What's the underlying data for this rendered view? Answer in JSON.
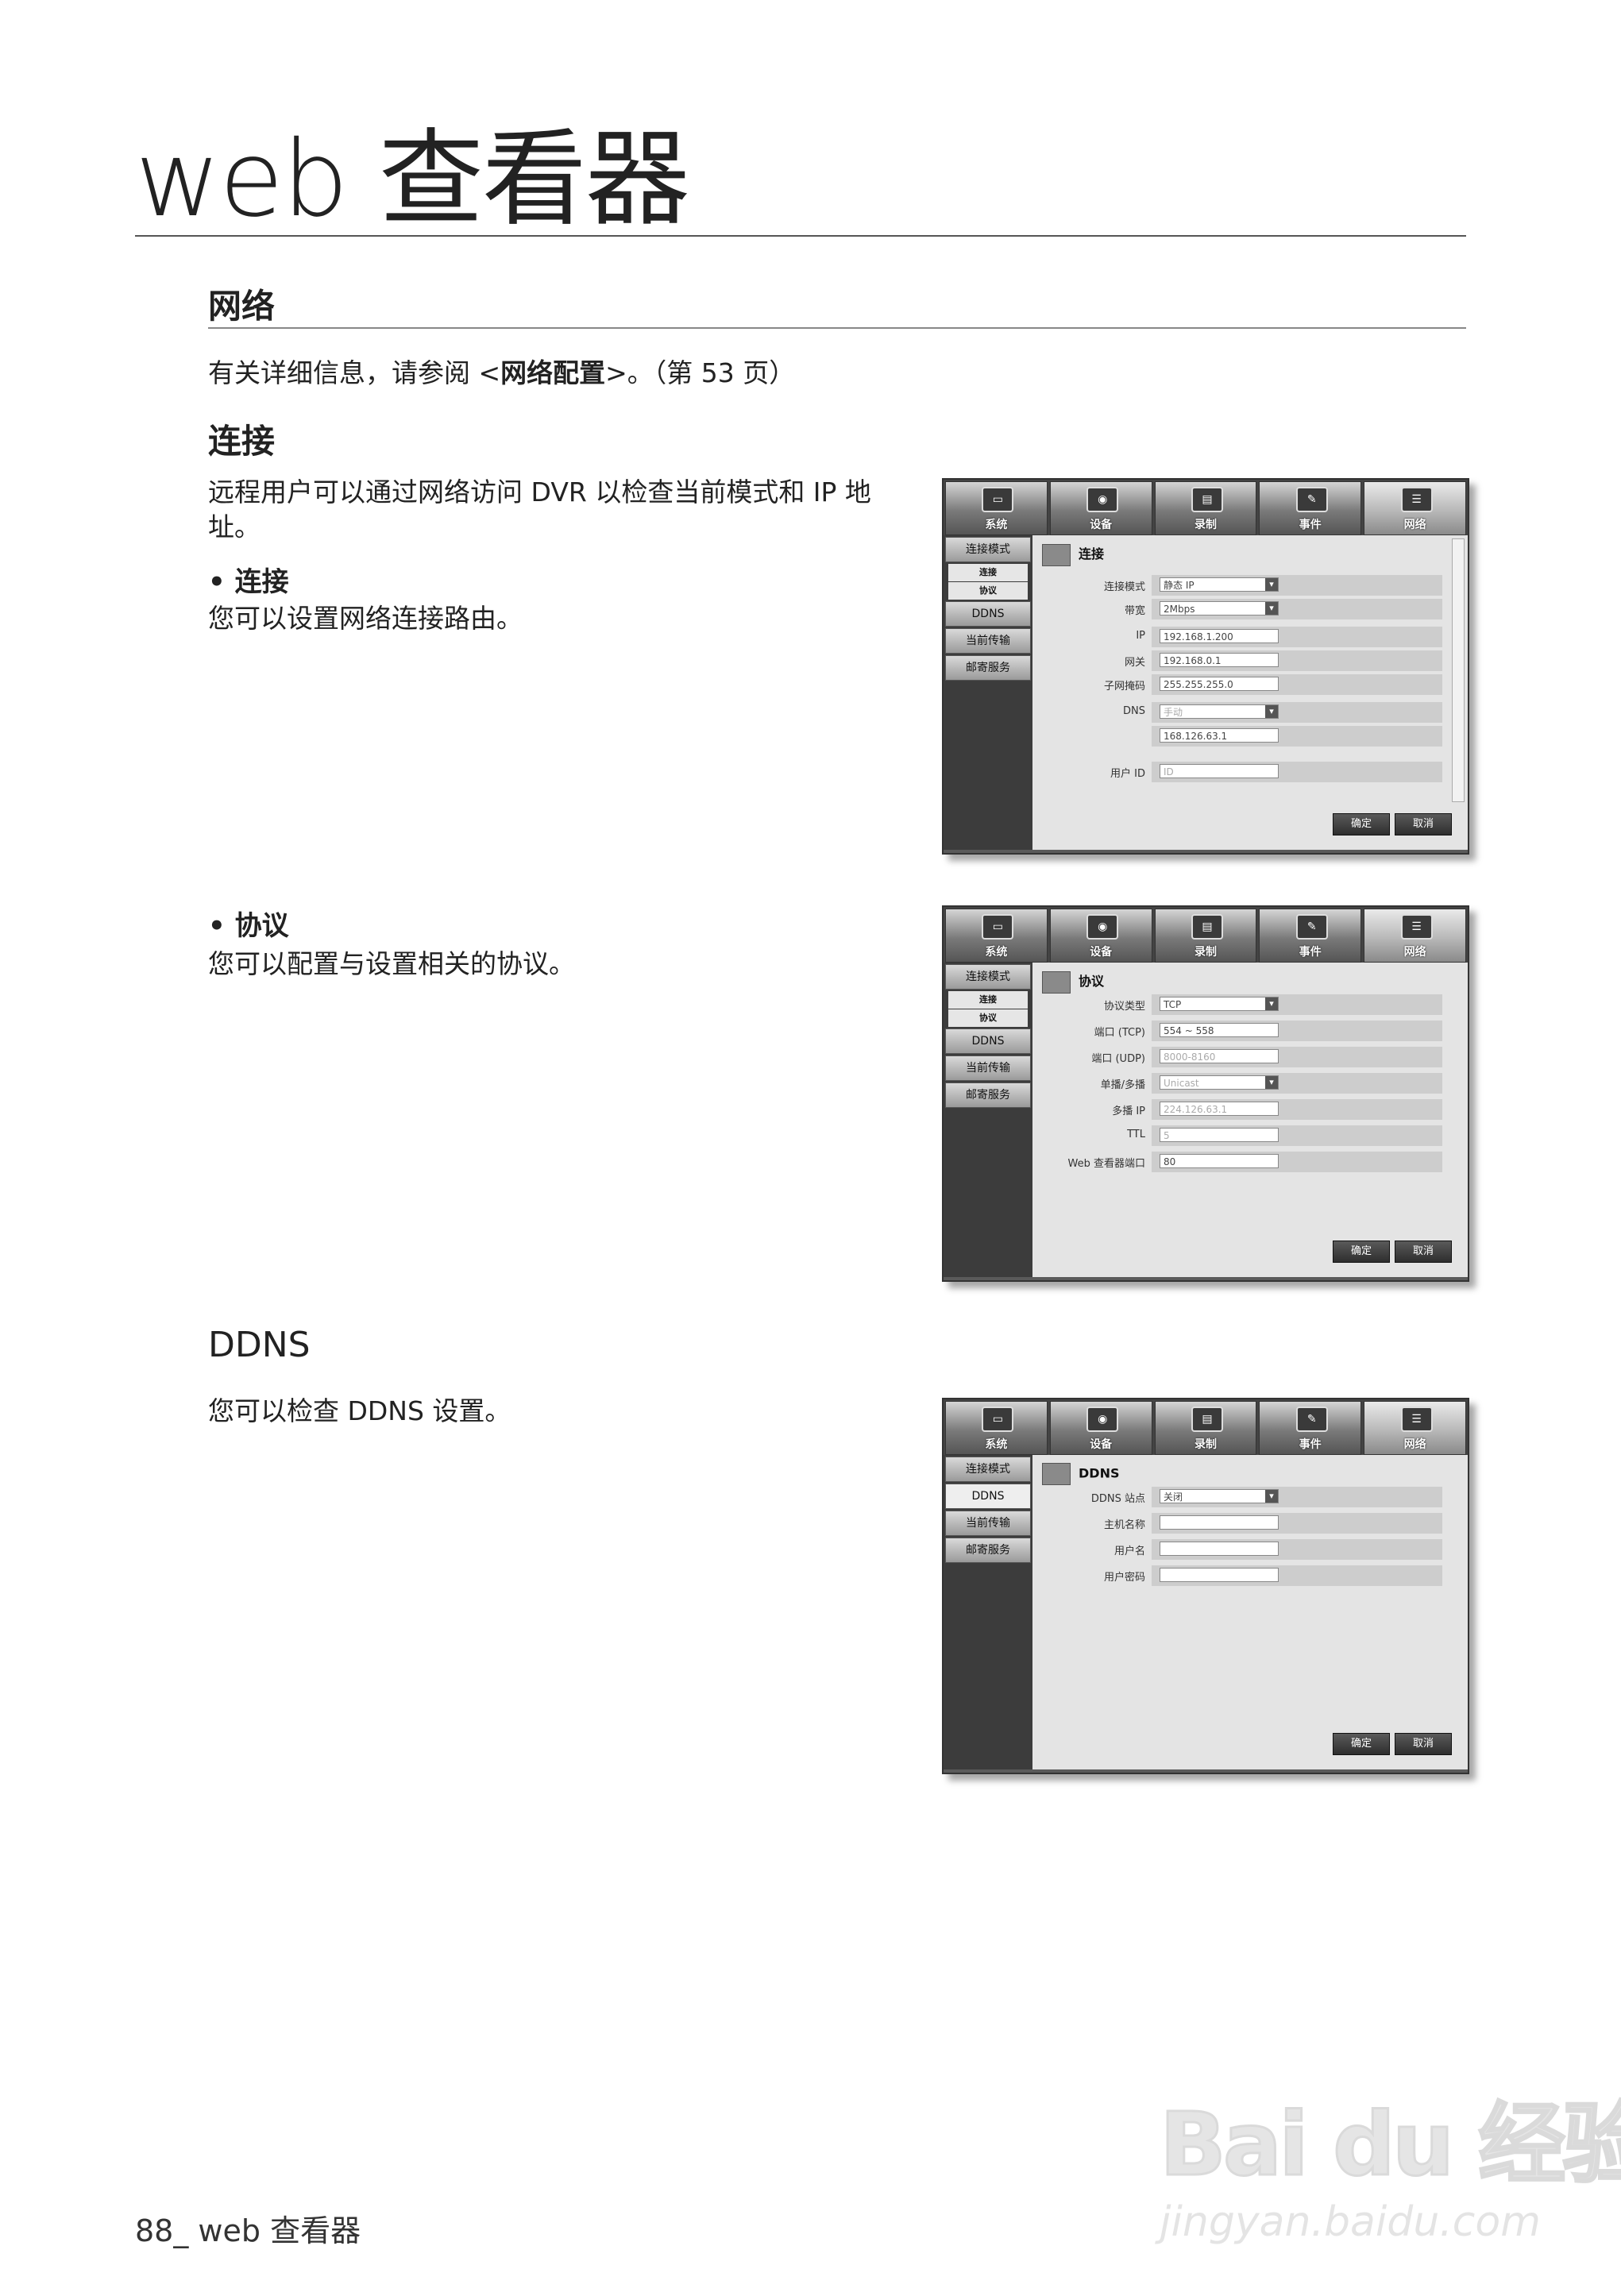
{
  "page": {
    "title": "web 查看器",
    "footer": "88_ web 查看器"
  },
  "network": {
    "heading": "网络",
    "ref_prefix": "有关详细信息，请参阅 <",
    "ref_link": "网络配置",
    "ref_suffix": ">。（第 53 页）"
  },
  "connection": {
    "heading": "连接",
    "desc": "远程用户可以通过网络访问 DVR 以检查当前模式和 IP 地址。",
    "bullet1_title": "• 连接",
    "bullet1_desc": "您可以设置网络连接路由。",
    "bullet2_title": "• 协议",
    "bullet2_desc": "您可以配置与设置相关的协议。"
  },
  "ddns": {
    "heading": "DDNS",
    "desc": "您可以检查 DDNS 设置。"
  },
  "watermark": {
    "logo": "Bai du 经验",
    "url": "jingyan.baidu.com"
  },
  "ui": {
    "tabs": [
      {
        "label": "系统",
        "icon": "monitor-icon"
      },
      {
        "label": "设备",
        "icon": "camera-icon"
      },
      {
        "label": "录制",
        "icon": "rec-icon"
      },
      {
        "label": "事件",
        "icon": "event-icon"
      },
      {
        "label": "网络",
        "icon": "network-icon"
      }
    ],
    "side": {
      "conn_mode": "连接模式",
      "sub_conn": "连接",
      "sub_proto": "协议",
      "ddns": "DDNS",
      "transfer": "当前传输",
      "mail": "邮寄服务"
    },
    "buttons": {
      "ok": "确定",
      "cancel": "取消"
    },
    "shot1": {
      "title": "连接",
      "labels": [
        "连接模式",
        "带宽",
        "IP",
        "网关",
        "子网掩码",
        "DNS",
        "",
        "用户 ID"
      ],
      "values": [
        "静态 IP",
        "2Mbps",
        "192.168.1.200",
        "192.168.0.1",
        "255.255.255.0",
        "手动",
        "168.126.63.1",
        "ID"
      ]
    },
    "shot2": {
      "title": "协议",
      "labels": [
        "协议类型",
        "端口 (TCP)",
        "端口 (UDP)",
        "单播/多播",
        "多播 IP",
        "TTL",
        "Web 查看器端口"
      ],
      "values": [
        "TCP",
        "554 ~ 558",
        "8000-8160",
        "Unicast",
        "224.126.63.1",
        "5",
        "80"
      ]
    },
    "shot3": {
      "title": "DDNS",
      "labels": [
        "DDNS 站点",
        "主机名称",
        "用户名",
        "用户密码"
      ],
      "values": [
        "关闭",
        "",
        "",
        ""
      ]
    }
  }
}
